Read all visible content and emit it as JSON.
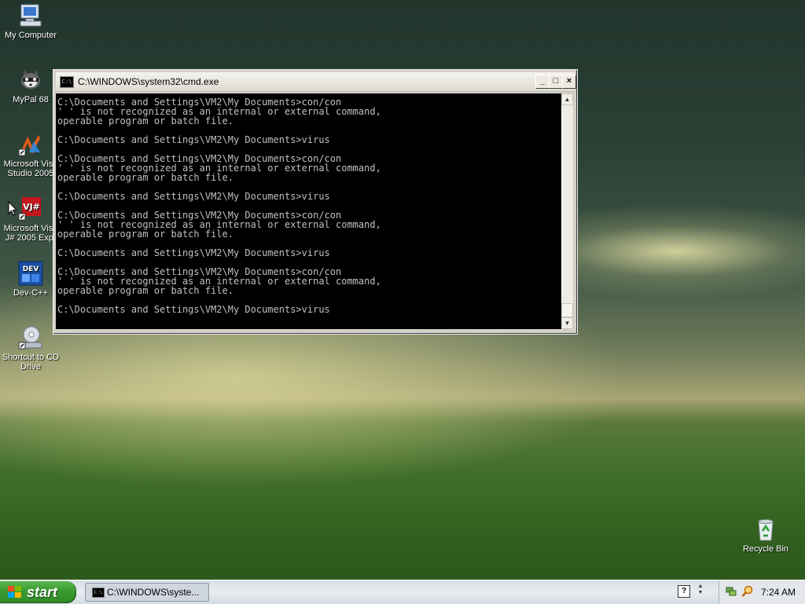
{
  "desktop": {
    "icons": [
      {
        "label": "My Computer",
        "icon": "my-computer-icon"
      },
      {
        "label": "MyPal 68",
        "icon": "mypal-raccoon-icon"
      },
      {
        "label": "Microsoft Visu\nStudio 2005",
        "icon": "visual-studio-icon"
      },
      {
        "label": "Microsoft Visu\nJ# 2005 Exp.",
        "icon": "vj-sharp-icon"
      },
      {
        "label": "Dev-C++",
        "icon": "dev-cpp-icon"
      },
      {
        "label": "Shortcut to CD\nDrive",
        "icon": "cd-drive-icon"
      },
      {
        "label": "Recycle Bin",
        "icon": "recycle-bin-icon"
      }
    ]
  },
  "cmd": {
    "title": "C:\\WINDOWS\\system32\\cmd.exe",
    "icon_text": "C:\\",
    "buttons": {
      "minimize": "_",
      "maximize": "□",
      "close": "×"
    },
    "output": "C:\\Documents and Settings\\VM2\\My Documents>con/con\n' ' is not recognized as an internal or external command,\noperable program or batch file.\n\nC:\\Documents and Settings\\VM2\\My Documents>virus\n\nC:\\Documents and Settings\\VM2\\My Documents>con/con\n' ' is not recognized as an internal or external command,\noperable program or batch file.\n\nC:\\Documents and Settings\\VM2\\My Documents>virus\n\nC:\\Documents and Settings\\VM2\\My Documents>con/con\n' ' is not recognized as an internal or external command,\noperable program or batch file.\n\nC:\\Documents and Settings\\VM2\\My Documents>virus\n\nC:\\Documents and Settings\\VM2\\My Documents>con/con\n' ' is not recognized as an internal or external command,\noperable program or batch file.\n\nC:\\Documents and Settings\\VM2\\My Documents>virus",
    "scroll": {
      "up": "▲",
      "down": "▼"
    }
  },
  "taskbar": {
    "start_label": "start",
    "task_label": "C:\\WINDOWS\\syste...",
    "task_icon_text": "C:\\",
    "help_glyph": "?",
    "tray_arrows": "▲\n▼",
    "clock": "7:24 AM"
  },
  "colors": {
    "console_bg": "#000000",
    "console_text": "#c0c0c0",
    "start_green": "#3a9a30",
    "taskbar": "#dfe4ea"
  }
}
